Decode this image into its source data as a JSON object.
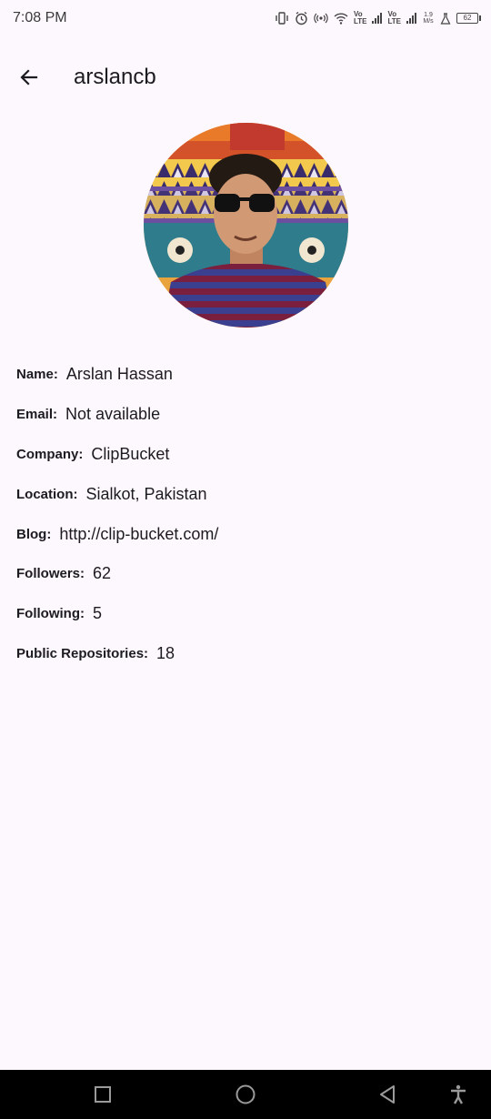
{
  "status_bar": {
    "time": "7:08 PM",
    "icons": [
      "vibrate-icon",
      "alarm-icon",
      "hotspot-icon",
      "wifi-icon",
      "volte-icon",
      "signal-icon",
      "volte-icon",
      "signal-icon",
      "speed-icon",
      "battery-icon"
    ],
    "net_speed": "1.9 M/s",
    "lte1_top": "Vo",
    "lte1_bottom": "LTE",
    "lte2_top": "Vo",
    "lte2_bottom": "LTE",
    "battery_level": "62"
  },
  "app_bar": {
    "title": "arslancb",
    "back_icon": "arrow-left-icon"
  },
  "profile": {
    "avatar_alt": "avatar",
    "fields": [
      {
        "label": "Name:",
        "value": "Arslan Hassan"
      },
      {
        "label": "Email:",
        "value": "Not available"
      },
      {
        "label": "Company:",
        "value": "ClipBucket"
      },
      {
        "label": "Location:",
        "value": "Sialkot, Pakistan"
      },
      {
        "label": "Blog:",
        "value": "http://clip-bucket.com/"
      },
      {
        "label": "Followers:",
        "value": "62"
      },
      {
        "label": "Following:",
        "value": "5"
      },
      {
        "label": "Public Repositories:",
        "value": "18"
      }
    ]
  },
  "nav_bar": {
    "recent_icon": "square-icon",
    "home_icon": "circle-icon",
    "back_icon": "triangle-back-icon",
    "accessibility_icon": "accessibility-icon"
  },
  "colors": {
    "background": "#fdf8fd",
    "text": "#1c1b1f",
    "nav": "#000000"
  }
}
